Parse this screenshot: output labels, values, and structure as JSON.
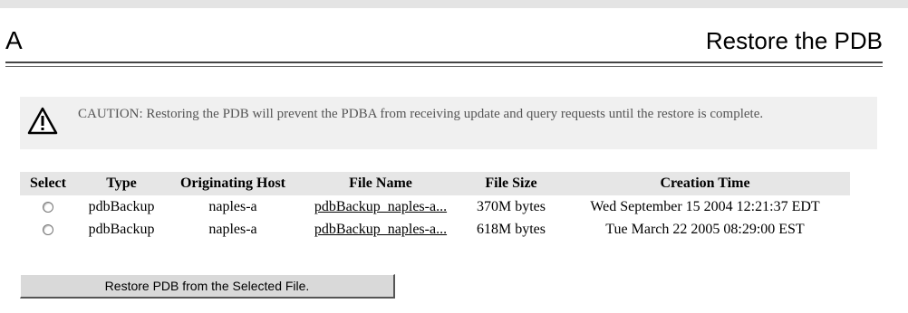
{
  "header": {
    "letter": "A",
    "title": "Restore the PDB"
  },
  "caution": {
    "label": "CAUTION:",
    "message": "Restoring the PDB will prevent the PDBA from receiving update and query requests until the restore is complete."
  },
  "table": {
    "columns": [
      "Select",
      "Type",
      "Originating Host",
      "File Name",
      "File Size",
      "Creation Time"
    ],
    "rows": [
      {
        "type": "pdbBackup",
        "host": "naples-a",
        "file": "pdbBackup_naples-a...",
        "size": "370M bytes",
        "created": "Wed September 15 2004 12:21:37 EDT"
      },
      {
        "type": "pdbBackup",
        "host": "naples-a",
        "file": "pdbBackup_naples-a...",
        "size": "618M bytes",
        "created": "Tue March 22 2005 08:29:00 EST"
      }
    ]
  },
  "button": {
    "label": "Restore PDB from the Selected File."
  },
  "colors": {
    "caution_bg": "#f0f0f0",
    "header_bg": "#e6e6e6"
  },
  "icons": {
    "caution": "warning-triangle-icon"
  }
}
